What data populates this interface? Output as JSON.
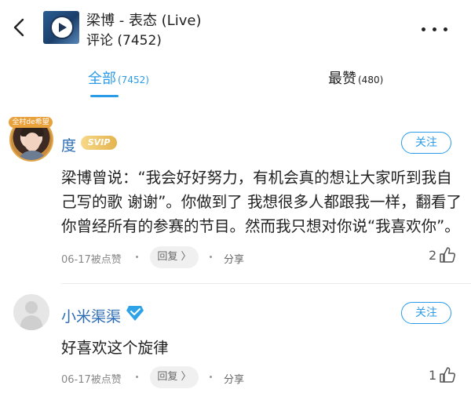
{
  "header": {
    "title": "梁博 - 表态 (Live)",
    "comment_count": "评论 (7452)"
  },
  "tabs": [
    {
      "label": "全部",
      "count": "(7452)",
      "active": true
    },
    {
      "label": "最赞",
      "count": "(480)",
      "active": false
    }
  ],
  "colors": {
    "accent": "#2b9be8",
    "username": "#2d6db5"
  },
  "comments": [
    {
      "username": "度",
      "badge": "SVIP",
      "avatar_banner": "全村de希望",
      "follow": "关注",
      "text": "梁博曾说：“我会好好努力，有机会真的想让大家听到我自己写的歌 谢谢”。你做到了 我想很多人都跟我一样，翻看了你曾经所有的参赛的节目。然而我只想对你说“我喜欢你”。",
      "time": "06-17被点赞",
      "reply": "回复 〉",
      "share": "分享",
      "likes": "2"
    },
    {
      "username": "小米渠渠",
      "badge_icon": "diamond-icon",
      "follow": "关注",
      "text": "好喜欢这个旋律",
      "time": "06-17被点赞",
      "reply": "回复 〉",
      "share": "分享",
      "likes": "1"
    }
  ]
}
